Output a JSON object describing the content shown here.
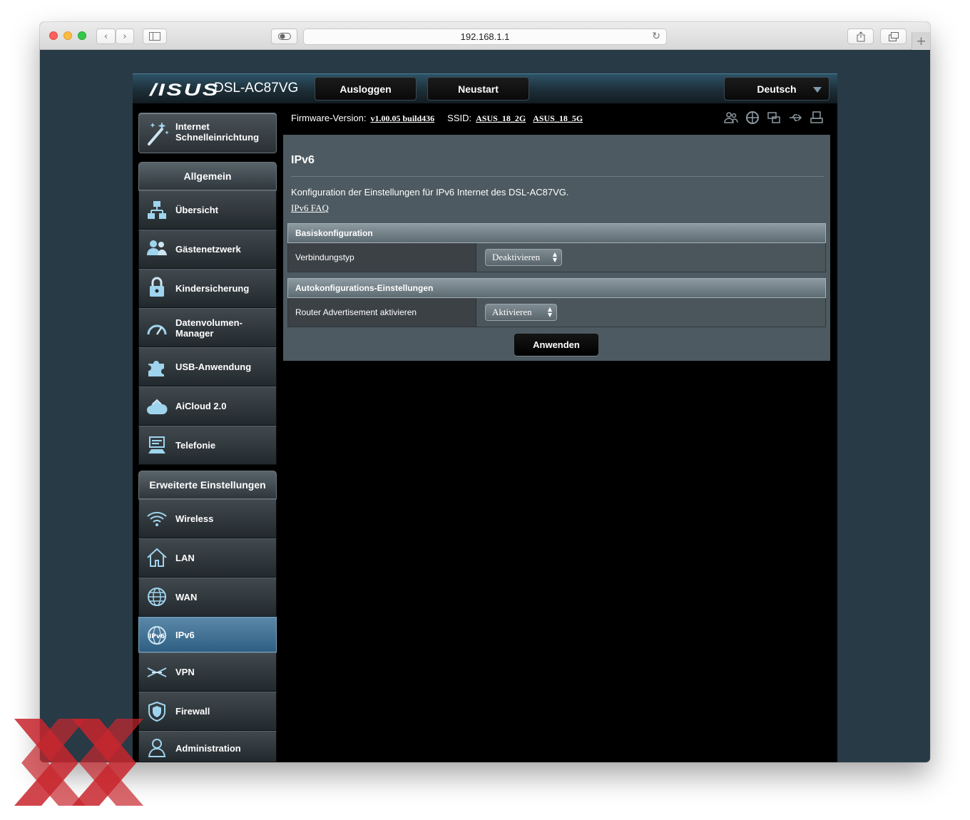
{
  "browser": {
    "url": "192.168.1.1",
    "icons": {
      "back": "chevron-left-icon",
      "forward": "chevron-right-icon",
      "sidebar": "sidebar-icon",
      "privacy": "toggle-icon",
      "reload": "reload-icon",
      "share": "share-icon",
      "tabs": "tabs-icon",
      "new_tab": "plus-icon"
    }
  },
  "header": {
    "brand": "/ISUS",
    "model": "DSL-AC87VG",
    "logout_label": "Ausloggen",
    "reboot_label": "Neustart",
    "language": "Deutsch"
  },
  "sidebar": {
    "quick_setup_label": "Internet Schnelleinrichtung",
    "general_heading": "Allgemein",
    "general_items": [
      {
        "label": "Übersicht",
        "icon": "network-map-icon"
      },
      {
        "label": "Gästenetzwerk",
        "icon": "guest-network-icon"
      },
      {
        "label": "Kindersicherung",
        "icon": "lock-icon"
      },
      {
        "label": "Datenvolumen-Manager",
        "icon": "gauge-icon"
      },
      {
        "label": "USB-Anwendung",
        "icon": "puzzle-icon"
      },
      {
        "label": "AiCloud 2.0",
        "icon": "cloud-icon"
      },
      {
        "label": "Telefonie",
        "icon": "telephone-icon"
      }
    ],
    "advanced_heading": "Erweiterte Einstellungen",
    "advanced_items": [
      {
        "label": "Wireless",
        "icon": "wifi-icon"
      },
      {
        "label": "LAN",
        "icon": "home-icon"
      },
      {
        "label": "WAN",
        "icon": "globe-icon"
      },
      {
        "label": "IPv6",
        "icon": "ipv6-globe-icon",
        "active": true
      },
      {
        "label": "VPN",
        "icon": "vpn-icon"
      },
      {
        "label": "Firewall",
        "icon": "shield-icon"
      },
      {
        "label": "Administration",
        "icon": "user-admin-icon"
      }
    ]
  },
  "infobar": {
    "firmware_label": "Firmware-Version:",
    "firmware_value": "v1.00.05 build436",
    "ssid_label": "SSID:",
    "ssid_2g": "ASUS_18_2G",
    "ssid_5g": "ASUS_18_5G",
    "status_icons": [
      "clients-icon",
      "internet-icon",
      "devices-icon",
      "usb-icon",
      "printer-icon"
    ]
  },
  "content": {
    "title": "IPv6",
    "description": "Konfiguration der Einstellungen für IPv6 Internet des DSL-AC87VG.",
    "faq_link": "IPv6 FAQ",
    "basic_heading": "Basiskonfiguration",
    "connection_type_label": "Verbindungstyp",
    "connection_type_value": "Deaktivieren",
    "auto_heading": "Autokonfigurations-Einstellungen",
    "router_adv_label": "Router Advertisement aktivieren",
    "router_adv_value": "Aktivieren",
    "apply_label": "Anwenden"
  },
  "colors": {
    "active_nav": "#2e5f83",
    "panel": "#4d5a61",
    "page_bg": "#273a46",
    "watermark": "#c8262d"
  }
}
